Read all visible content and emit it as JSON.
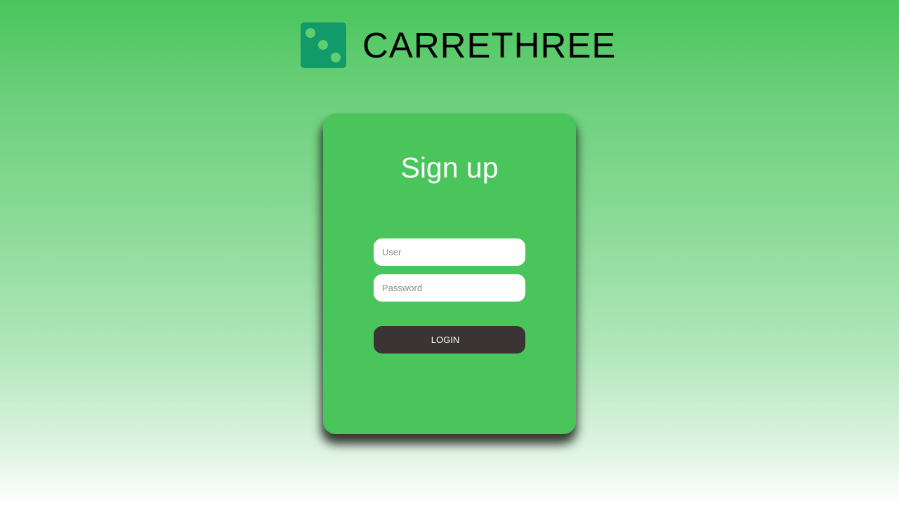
{
  "brand": {
    "name": "CARRETHREE",
    "logo_icon": "dice-three-icon",
    "logo_color": "#139a6a",
    "logo_dot_color": "#5fd06f"
  },
  "form": {
    "title": "Sign up",
    "user_placeholder": "User",
    "user_value": "",
    "password_placeholder": "Password",
    "password_value": "",
    "login_label": "LOGIN"
  },
  "colors": {
    "card_background": "#49c55b",
    "button_background": "#3a3435",
    "text_on_card": "#ffffff"
  }
}
